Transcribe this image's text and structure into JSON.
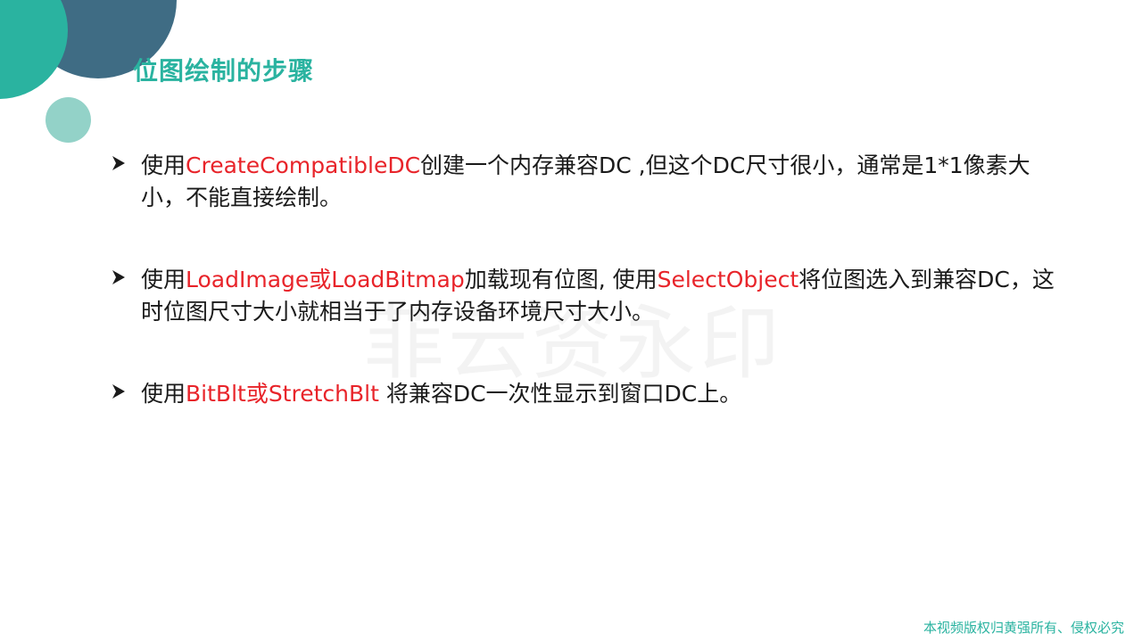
{
  "slide": {
    "title": "位图绘制的步骤",
    "watermark": "菲云资永印",
    "footer": "本视频版权归黄强所有、侵权必究",
    "bullets": [
      {
        "s1": "使用",
        "s2": "CreateCompatibleDC",
        "s3": "创建一个内存兼容DC ,但这个DC尺寸很小，通常是1*1像素大小，不能直接绘制。"
      },
      {
        "s1": "使用",
        "s2": "LoadImage或LoadBitmap",
        "s3": "加载现有位图, 使用",
        "s4": "SelectObject",
        "s5": "将位图选入到兼容DC，这时位图尺寸大小就相当于了内存设备环境尺寸大小。"
      },
      {
        "s1": "使用",
        "s2": "BitBlt或StretchBlt",
        "s3": " 将兼容DC一次性显示到窗口DC上。"
      }
    ]
  },
  "colors": {
    "accent": "#2ab3a0",
    "navy": "#2f5f7a",
    "highlight": "#e8242a",
    "text": "#1a1a1a"
  },
  "icons": {
    "bullet": "arrow-bullet-icon"
  }
}
